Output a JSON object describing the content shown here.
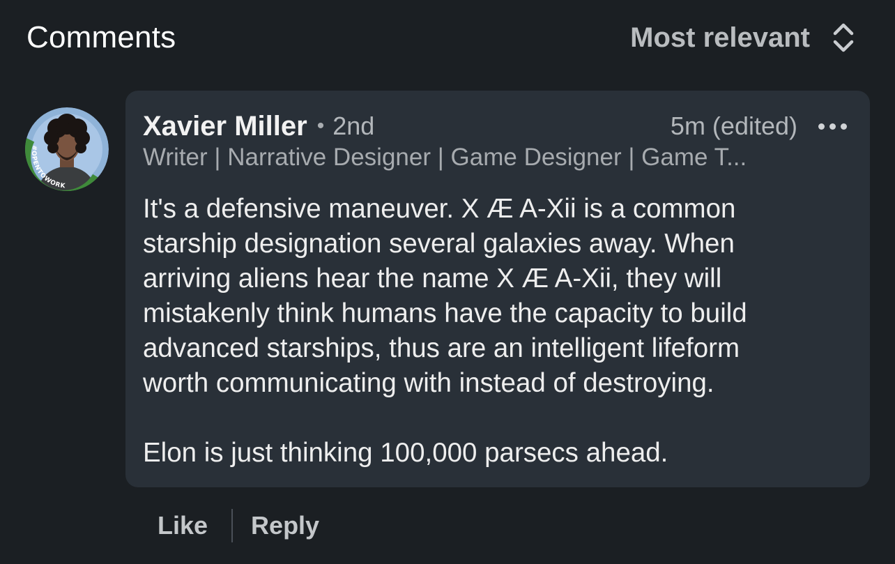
{
  "header": {
    "title": "Comments",
    "sort_label": "Most relevant",
    "sort_icon": "up-down-chevron-icon"
  },
  "comment": {
    "avatar": {
      "badge_text": "#OPENTOWORK",
      "badge_color": "#3f8a3a",
      "ring_color": "#8fb3d8"
    },
    "author": {
      "name": "Xavier Miller",
      "separator": "•",
      "degree": "2nd",
      "headline": "Writer | Narrative Designer | Game Designer | Game T..."
    },
    "timestamp": "5m (edited)",
    "more_icon": "more-horizontal-icon",
    "body_lines": [
      "It's a defensive maneuver. X Æ A-Xii is a common",
      "starship designation several galaxies away. When",
      "arriving aliens hear the name X Æ A-Xii, they will",
      "mistakenly think humans have the capacity to build",
      "advanced starships, thus are an intelligent lifeform",
      "worth communicating with instead of destroying."
    ],
    "body_last": "Elon is just thinking 100,000 parsecs ahead.",
    "actions": {
      "like": "Like",
      "reply": "Reply"
    }
  },
  "colors": {
    "background": "#1b1f23",
    "bubble": "#293038"
  }
}
